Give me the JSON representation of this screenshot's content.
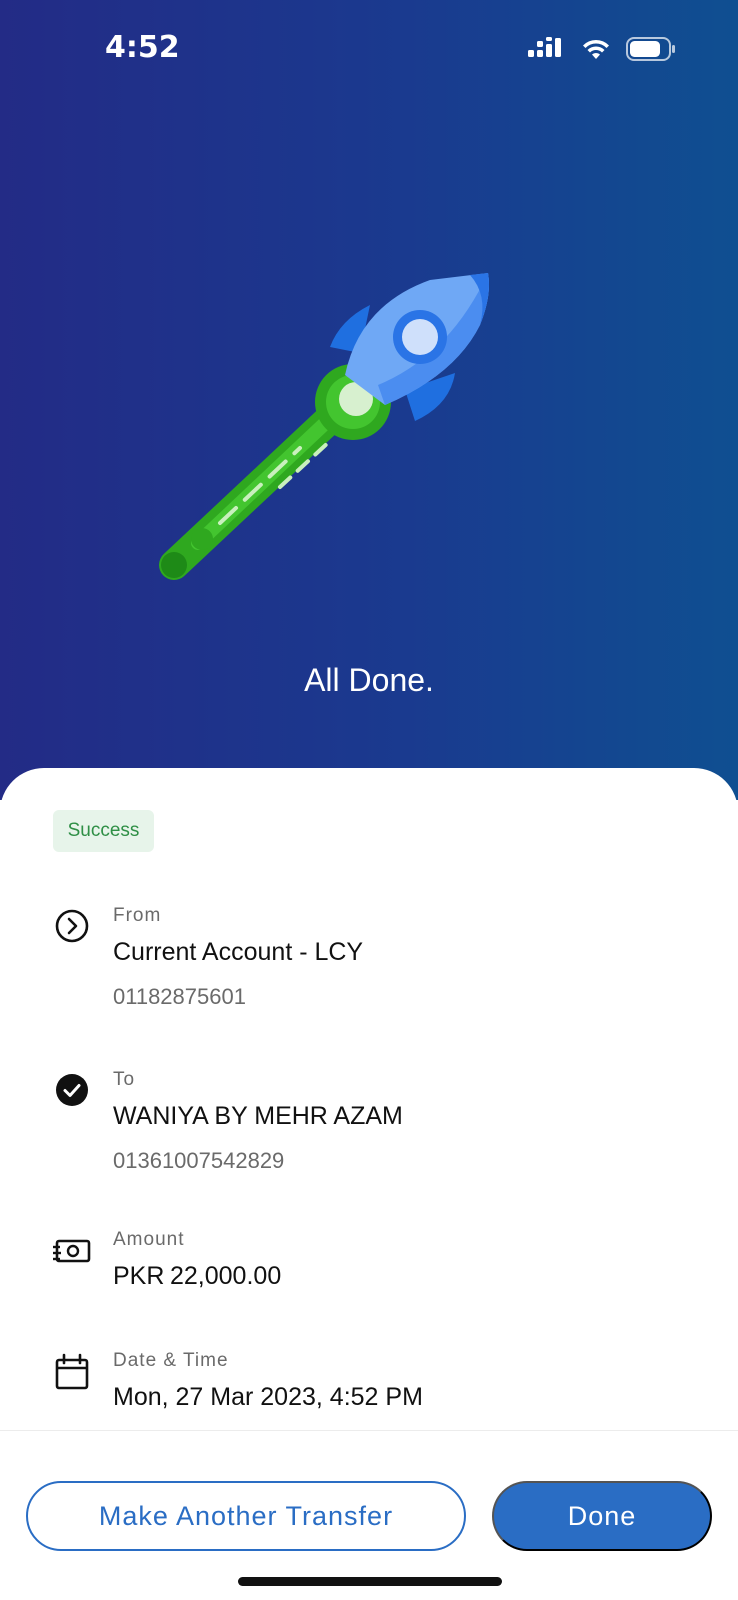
{
  "status_bar": {
    "time": "4:52",
    "icons": [
      "cellular-signal-icon",
      "wifi-icon",
      "battery-icon"
    ]
  },
  "hero": {
    "illustration": "rocket-icon",
    "title": "All Done."
  },
  "badge": {
    "label": "Success"
  },
  "details": {
    "from": {
      "label": "From",
      "value": "Current Account - LCY",
      "sub": "01182875601",
      "icon": "arrow-right-circle-icon"
    },
    "to": {
      "label": "To",
      "value": "WANIYA BY MEHR AZAM",
      "sub": "01361007542829",
      "icon": "check-circle-icon"
    },
    "amount": {
      "label": "Amount",
      "currency": "PKR",
      "value": "22,000.00",
      "icon": "cash-icon"
    },
    "datetime": {
      "label": "Date & Time",
      "value": "Mon, 27 Mar 2023, 4:52 PM",
      "icon": "calendar-icon"
    }
  },
  "actions": {
    "make_another_transfer": "Make Another Transfer",
    "done": "Done"
  },
  "colors": {
    "hero_gradient_start": "#232b86",
    "hero_gradient_end": "#0f4f91",
    "primary": "#2a6dc4",
    "success_text": "#2f8f46",
    "success_bg": "#e7f4ea"
  }
}
